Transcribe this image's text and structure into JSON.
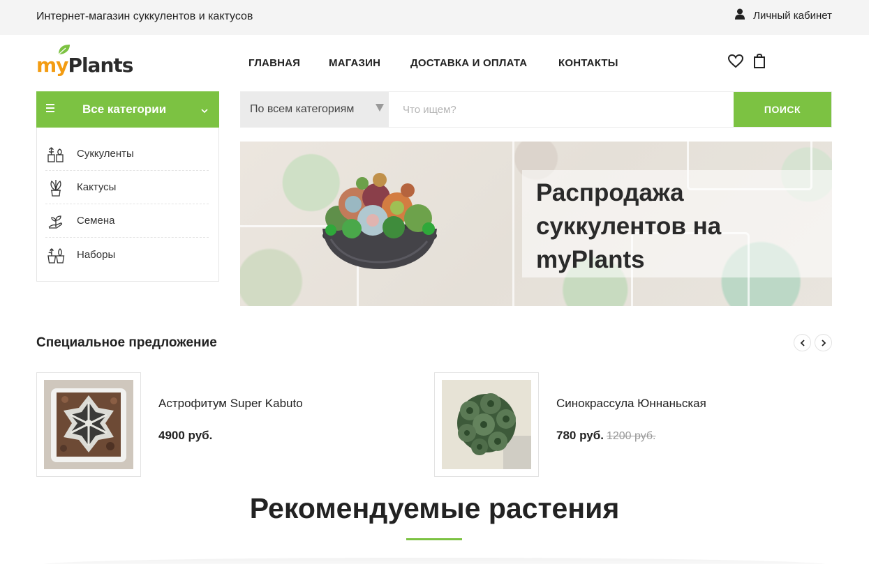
{
  "topbar": {
    "tagline": "Интернет-магазин суккулентов и кактусов",
    "account_label": "Личный кабинет",
    "account_icon": "user-icon"
  },
  "logo": {
    "part1": "my",
    "part2": "Plants"
  },
  "nav": {
    "items": [
      "ГЛАВНАЯ",
      "МАГАЗИН",
      "ДОСТАВКА И ОПЛАТА",
      "КОНТАКТЫ"
    ]
  },
  "header_icons": [
    "heart-icon",
    "shopping-bag-icon"
  ],
  "categories": {
    "title": "Все категории",
    "items": [
      {
        "label": "Суккуленты",
        "icon": "succulents-icon"
      },
      {
        "label": "Кактусы",
        "icon": "cactus-icon"
      },
      {
        "label": "Семена",
        "icon": "seeds-icon"
      },
      {
        "label": "Наборы",
        "icon": "sets-icon"
      }
    ]
  },
  "search": {
    "category_select": "По всем категориям",
    "placeholder": "Что ищем?",
    "button": "ПОИСК"
  },
  "banner": {
    "headline": "Распродажа суккулентов на myPlants"
  },
  "special": {
    "title": "Специальное предложение",
    "products": [
      {
        "name": "Астрофитум Super Kabuto",
        "price": "4900 руб.",
        "old_price": ""
      },
      {
        "name": "Синокрассула Юннаньская",
        "price": "780 руб.",
        "old_price": "1200 руб."
      }
    ]
  },
  "recommended": {
    "title": "Рекомендуемые растения"
  },
  "colors": {
    "accent": "#7cc242",
    "logo_orange": "#f39c12"
  }
}
